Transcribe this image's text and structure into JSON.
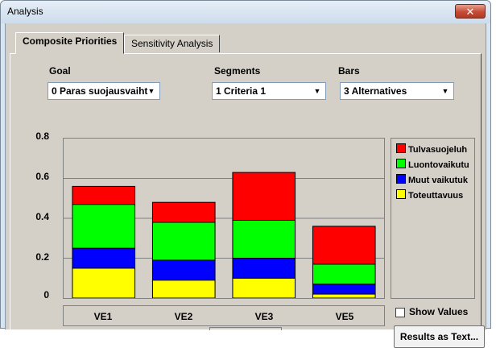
{
  "window": {
    "title": "Analysis",
    "close_label": "✕"
  },
  "tabs": [
    {
      "label": "Composite Priorities",
      "active": true
    },
    {
      "label": "Sensitivity Analysis",
      "active": false
    }
  ],
  "controls": {
    "goal": {
      "label": "Goal",
      "value": "0 Paras suojausvaiht"
    },
    "segments": {
      "label": "Segments",
      "value": "1 Criteria 1"
    },
    "bars": {
      "label": "Bars",
      "value": "3 Alternatives"
    }
  },
  "show_values": {
    "label": "Show Values",
    "checked": false
  },
  "results_button": "Results as Text...",
  "colors": {
    "Tulvasuojeluh": "#ff0000",
    "Luontovaikutu": "#00ff00",
    "Muut vaikutuk": "#0000ff",
    "Toteuttavuus": "#ffff00",
    "background": "#d4d0c8"
  },
  "chart_data": {
    "type": "bar",
    "stacked": true,
    "categories": [
      "VE1",
      "VE2",
      "VE3",
      "VE5"
    ],
    "series": [
      {
        "name": "Toteuttavuus",
        "values": [
          0.15,
          0.09,
          0.1,
          0.02
        ]
      },
      {
        "name": "Muut vaikutuk",
        "values": [
          0.1,
          0.1,
          0.1,
          0.05
        ]
      },
      {
        "name": "Luontovaikutu",
        "values": [
          0.22,
          0.19,
          0.19,
          0.1
        ]
      },
      {
        "name": "Tulvasuojeluh",
        "values": [
          0.09,
          0.1,
          0.24,
          0.19
        ]
      }
    ],
    "ylim": [
      0,
      0.8
    ],
    "yticks": [
      "0",
      "0.2",
      "0.4",
      "0.6",
      "0.8"
    ],
    "grid": true,
    "legend": "right"
  }
}
